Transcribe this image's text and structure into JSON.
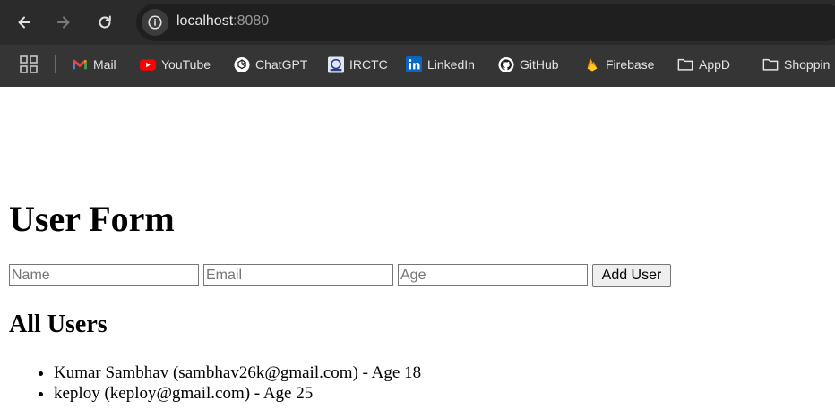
{
  "browser": {
    "url_host": "localhost",
    "url_port": ":8080",
    "bookmarks": [
      {
        "label": "Mail",
        "icon": "gmail-icon"
      },
      {
        "label": "YouTube",
        "icon": "youtube-icon"
      },
      {
        "label": "ChatGPT",
        "icon": "chatgpt-icon"
      },
      {
        "label": "IRCTC",
        "icon": "irctc-icon"
      },
      {
        "label": "LinkedIn",
        "icon": "linkedin-icon"
      },
      {
        "label": "GitHub",
        "icon": "github-icon"
      },
      {
        "label": "Firebase",
        "icon": "firebase-icon"
      },
      {
        "label": "AppD",
        "icon": "folder-icon"
      },
      {
        "label": "Shoppin",
        "icon": "folder-icon"
      }
    ]
  },
  "page": {
    "title": "User Form",
    "form": {
      "name_placeholder": "Name",
      "email_placeholder": "Email",
      "age_placeholder": "Age",
      "name_value": "",
      "email_value": "",
      "age_value": "",
      "submit_label": "Add User"
    },
    "list_title": "All Users",
    "users": [
      "Kumar Sambhav (sambhav26k@gmail.com) - Age 18",
      "keploy (keploy@gmail.com) - Age 25"
    ]
  },
  "colors": {
    "chrome_dark": "#2b2b2b",
    "bookmarks_bar": "#353535",
    "page_background": "#ffffff"
  }
}
